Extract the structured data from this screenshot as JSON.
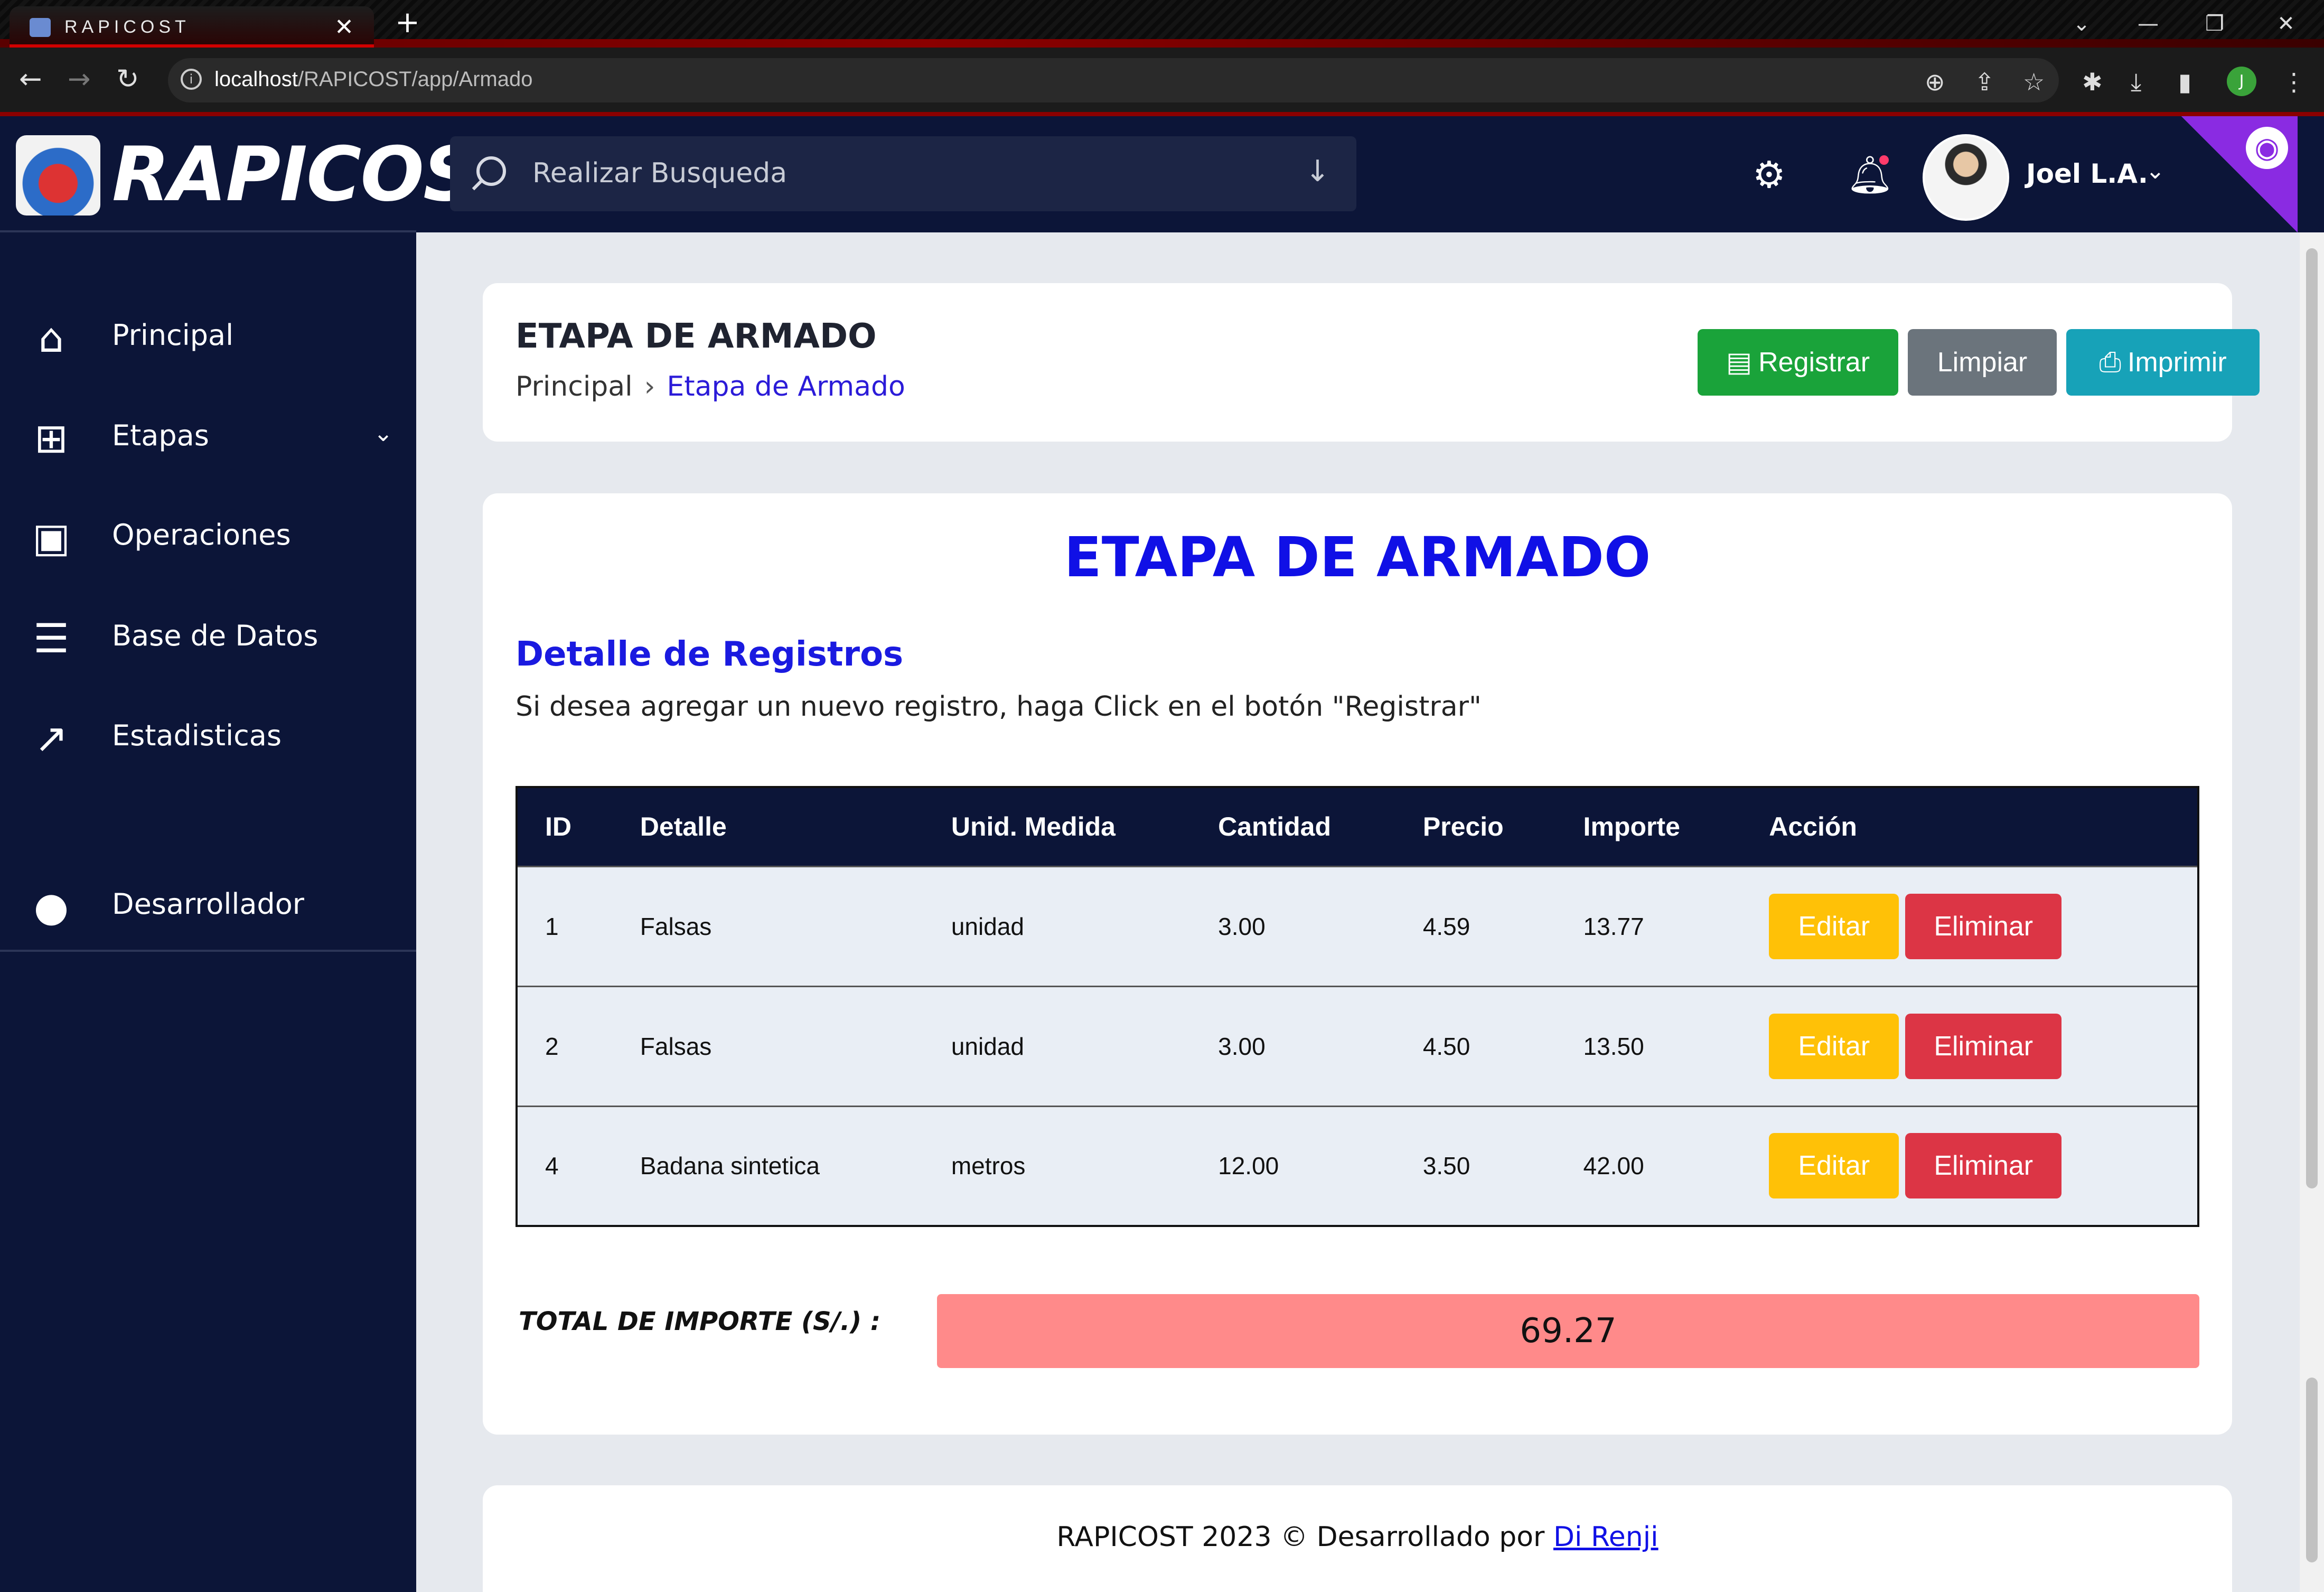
{
  "browser": {
    "tab_title": "RAPICOST",
    "tab_close": "✕",
    "new_tab": "+",
    "url_host": "localhost",
    "url_path": "/RAPICOST/app/Armado"
  },
  "app": {
    "brand": "RAPICOST",
    "search_placeholder": "Realizar Busqueda",
    "user_name": "Joel L.A."
  },
  "sidebar": {
    "items": [
      {
        "label": "Principal",
        "icon": "home-icon"
      },
      {
        "label": "Etapas",
        "icon": "sitemap-icon"
      },
      {
        "label": "Operaciones",
        "icon": "money-icon"
      },
      {
        "label": "Base de Datos",
        "icon": "database-icon"
      },
      {
        "label": "Estadisticas",
        "icon": "chart-line-icon"
      },
      {
        "label": "Desarrollador",
        "icon": "github-icon"
      }
    ]
  },
  "header": {
    "title": "ETAPA DE ARMADO",
    "breadcrumb_home": "Principal",
    "breadcrumb_current": "Etapa de Armado",
    "register_label": "Registrar",
    "clear_label": "Limpiar",
    "print_label": "Imprimir"
  },
  "content": {
    "big_title": "ETAPA DE ARMADO",
    "subtitle": "Detalle de Registros",
    "description": "Si desea agregar un nuevo registro, haga Click en el botón \"Registrar\"",
    "table": {
      "headers": [
        "ID",
        "Detalle",
        "Unid. Medida",
        "Cantidad",
        "Precio",
        "Importe",
        "Acción"
      ],
      "rows": [
        [
          "1",
          "Falsas",
          "unidad",
          "3.00",
          "4.59",
          "13.77"
        ],
        [
          "2",
          "Falsas",
          "unidad",
          "3.00",
          "4.50",
          "13.50"
        ],
        [
          "4",
          "Badana sintetica",
          "metros",
          "12.00",
          "3.50",
          "42.00"
        ]
      ],
      "edit_label": "Editar",
      "delete_label": "Eliminar"
    },
    "total_label": "TOTAL DE IMPORTE (S/.) :",
    "total_value": "69.27"
  },
  "footer": {
    "text": "RAPICOST 2023 © Desarrollado por ",
    "link": "Di Renji"
  },
  "colors": {
    "navy": "#0c1538",
    "accent_blue": "#1010e6",
    "green": "#1aa33a",
    "gray": "#6b747c",
    "teal": "#17a2b8",
    "yellow": "#ffc107",
    "red": "#dc3545",
    "total_bg": "#ff8a8a"
  }
}
